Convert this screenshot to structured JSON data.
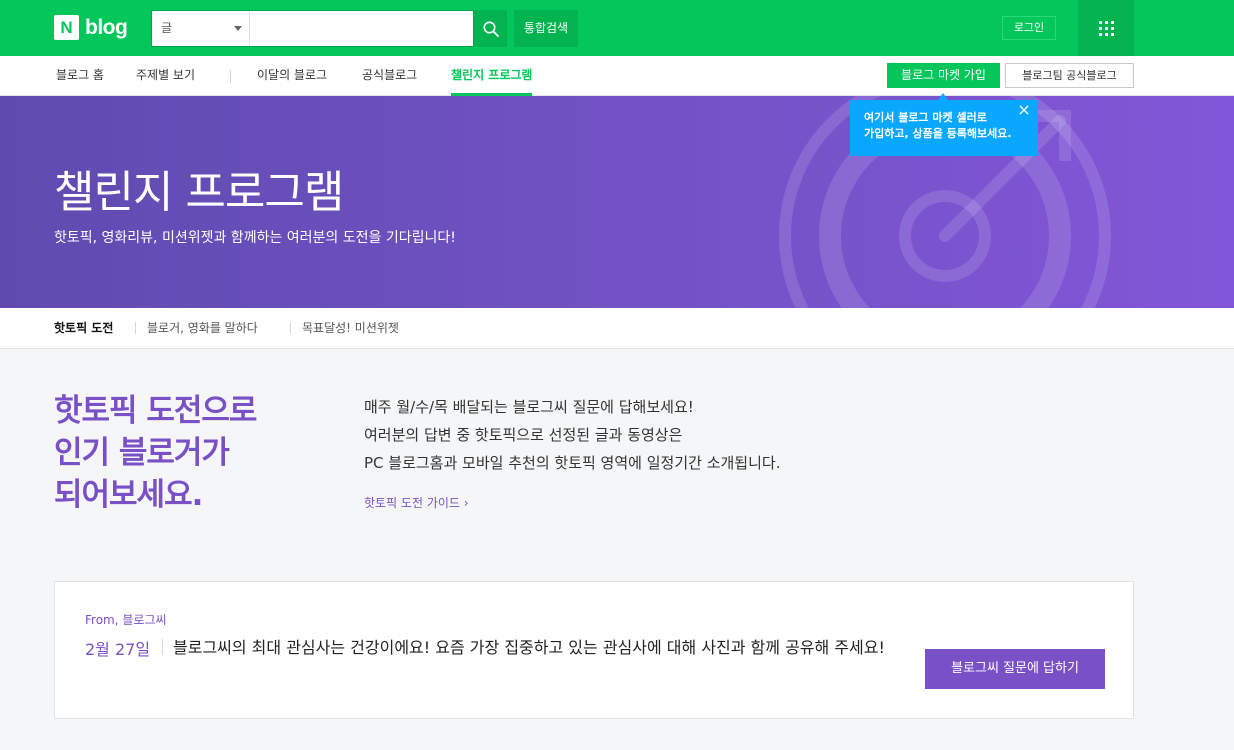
{
  "header": {
    "logo_letter": "N",
    "logo_text": "blog",
    "search_scope": "글",
    "search_placeholder": "",
    "total_search_label": "통합검색",
    "login_label": "로그인",
    "brand_color": "#03c75a"
  },
  "nav": {
    "items": [
      {
        "label": "블로그 홈",
        "active": false
      },
      {
        "label": "주제별 보기",
        "active": false
      },
      {
        "label": "이달의 블로그",
        "active": false
      },
      {
        "label": "공식블로그",
        "active": false
      },
      {
        "label": "챌린지 프로그램",
        "active": true
      }
    ],
    "market_button": "블로그 마켓 가입",
    "team_button": "블로그팀 공식블로그"
  },
  "tooltip": {
    "line1": "여기서 블로그 마켓 셀러로",
    "line2": "가입하고, 상품을 등록해보세요."
  },
  "hero": {
    "title": "챌린지 프로그램",
    "subtitle": "핫토픽, 영화리뷰, 미션위젯과 함께하는 여러분의 도전을 기다립니다!"
  },
  "subtabs": [
    {
      "label": "핫토픽 도전",
      "active": true
    },
    {
      "label": "블로거, 영화를 말하다",
      "active": false
    },
    {
      "label": "목표달성! 미션위젯",
      "active": false
    }
  ],
  "intro": {
    "headline": [
      "핫토픽 도전으로",
      "인기 블로거가",
      "되어보세요."
    ],
    "description": [
      "매주 월/수/목 배달되는 블로그씨 질문에 답해보세요!",
      "여러분의 답변 중 핫토픽으로 선정된 글과 동영상은",
      "PC 블로그홈과 모바일 추천의 핫토픽 영역에 일정기간 소개됩니다."
    ],
    "guide_link": "핫토픽 도전 가이드 ›",
    "accent_color": "#7a50c6"
  },
  "card": {
    "from_label": "From, 블로그씨",
    "date": "2월 27일",
    "question": "블로그씨의 최대 관심사는 건강이에요! 요즘 가장 집중하고 있는 관심사에 대해 사진과 함께 공유해 주세요!",
    "answer_button": "블로그씨 질문에 답하기"
  }
}
